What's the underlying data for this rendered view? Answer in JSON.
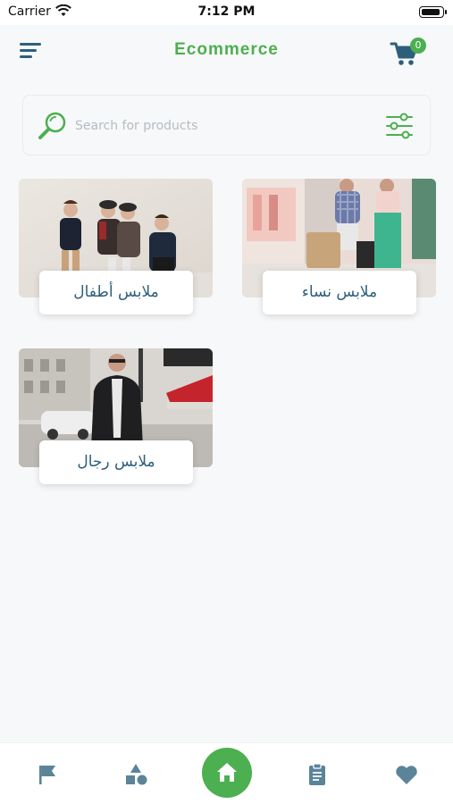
{
  "status_bar": {
    "carrier": "Carrier",
    "time": "7:12 PM"
  },
  "header": {
    "title": "Ecommerce",
    "cart_count": "0",
    "menu_icon": "menu-icon",
    "cart_icon": "cart-icon"
  },
  "search": {
    "placeholder": "Search for products",
    "value": "",
    "search_icon": "magnifier-icon",
    "filter_icon": "filter-sliders-icon"
  },
  "categories": [
    {
      "label": "ملابس أطفال",
      "image": "kids-clothes-photo"
    },
    {
      "label": "ملابس نساء",
      "image": "women-clothes-photo"
    },
    {
      "label": "ملابس رجال",
      "image": "men-clothes-photo"
    }
  ],
  "bottom_nav": {
    "items": [
      "flag-icon",
      "shapes-icon",
      "home-icon",
      "clipboard-icon",
      "heart-icon"
    ],
    "active": "home-icon"
  },
  "colors": {
    "accent": "#4caf50",
    "primary": "#2d5f7d",
    "nav_icon": "#5b8499",
    "background": "#f7f8f9"
  }
}
